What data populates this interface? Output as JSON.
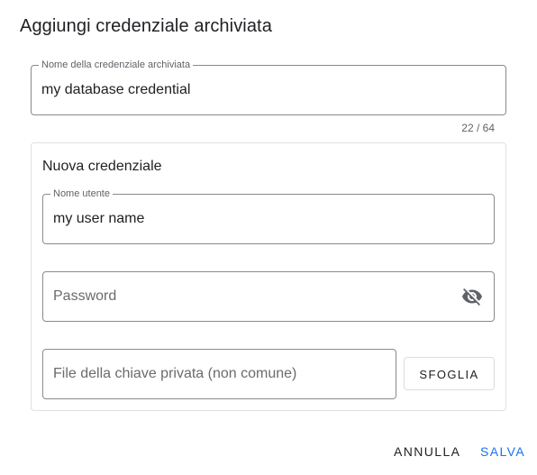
{
  "dialog": {
    "title": "Aggiungi credenziale archiviata"
  },
  "credential_name": {
    "label": "Nome della credenziale archiviata",
    "value": "my database credential",
    "counter": "22 / 64"
  },
  "new_credential": {
    "title": "Nuova credenziale",
    "username": {
      "label": "Nome utente",
      "value": "my user name"
    },
    "password": {
      "placeholder": "Password",
      "toggle_icon": "visibility-off-icon"
    },
    "private_key": {
      "placeholder": "File della chiave privata (non comune)",
      "browse_label": "SFOGLIA"
    }
  },
  "actions": {
    "cancel_label": "ANNULLA",
    "save_label": "SALVA"
  },
  "colors": {
    "accent": "#1a73e8",
    "border": "#8a8a8a"
  }
}
